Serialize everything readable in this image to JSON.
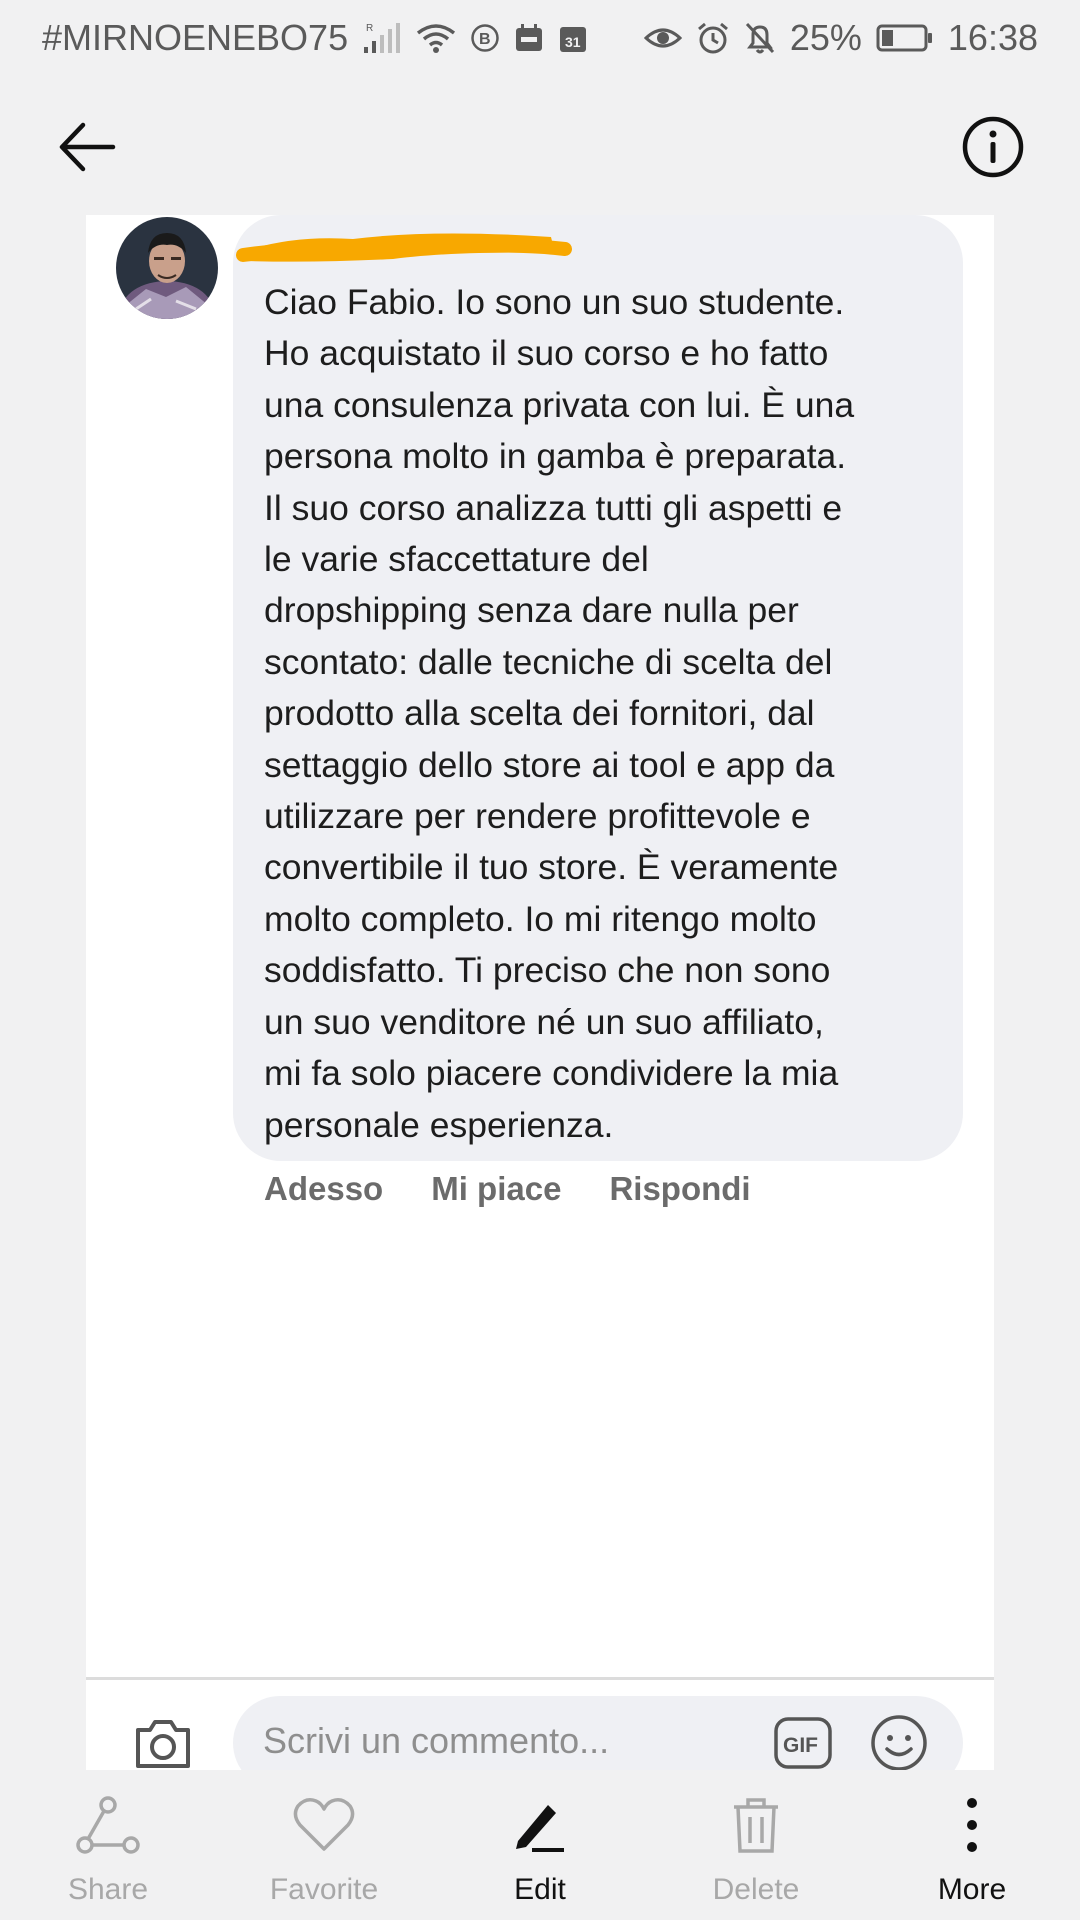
{
  "status_bar": {
    "carrier": "#MIRNOENEBO75",
    "battery": "25%",
    "time": "16:38",
    "calendar_day": "31"
  },
  "comment": {
    "text": "Ciao Fabio. Io sono un suo studente.\nHo acquistato il suo corso e ho fatto\nuna consulenza privata con lui. È una\npersona molto in gamba è preparata.\nIl suo corso analizza tutti gli aspetti e\nle varie sfaccettature del\ndropshipping senza dare nulla per\nscontato: dalle tecniche di scelta del\nprodotto alla scelta dei fornitori, dal\nsettaggio dello store ai tool e app da\nutilizzare per rendere profittevole e\nconvertibile il tuo store. È veramente\nmolto completo. Io mi ritengo molto\nsoddisfatto. Ti preciso che non sono\nun suo venditore né un suo affiliato,\nmi fa solo piacere condividere la mia\npersonale esperienza.",
    "actions": {
      "time": "Adesso",
      "like": "Mi piace",
      "reply": "Rispondi"
    }
  },
  "composer": {
    "placeholder": "Scrivi un commento...",
    "gif_label": "GIF"
  },
  "bottom_nav": {
    "share": "Share",
    "favorite": "Favorite",
    "edit": "Edit",
    "delete": "Delete",
    "more": "More"
  },
  "colors": {
    "redaction": "#f8a800",
    "bubble": "#eff0f4",
    "background": "#f1f1f2"
  }
}
